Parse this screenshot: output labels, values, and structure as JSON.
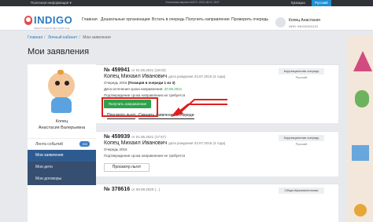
{
  "topbar": {
    "info": "Полезная информация ▾",
    "center": "Эталонная версия #0070: 2021.06.01 1537",
    "lang_kz": "Қазақша",
    "lang_ru": "Русский"
  },
  "header": {
    "logo": "INDIGO",
    "logo_sub": "ЭЛЕКТРОННЫЙ ДЕТСКИЙ САД",
    "nav": [
      "Главная",
      "Дошкольные организации",
      "Встать в очередь",
      "Получить направление",
      "Проверить очередь"
    ],
    "user_name": "Копец Анастасия",
    "user_iin": "ИИН: 940202401122"
  },
  "breadcrumbs": [
    "Главная",
    "Личный кабинет",
    "Мои заявления"
  ],
  "page_title": "Мои заявления",
  "sidebar": {
    "name_line1": "Копец",
    "name_line2": "Анастасия Валерьевна",
    "feed_label": "Лента событий",
    "feed_count": "153",
    "items": [
      "Мои заявления",
      "Мои дети",
      "Мои договоры"
    ]
  },
  "applications": [
    {
      "number": "№ 459941",
      "date": "от 01.06.2021 (18:03)",
      "child": "Копец Михаил Иванович",
      "dob": "дата рождения 23.07.2016 (4 года)",
      "queue": "Очередь 2016",
      "position_label": "Очередь 2016",
      "position": "(Позиция в очереди 1 из 3)",
      "expiry_label": "Дата истечения срока направления:",
      "expiry": "20.06.2021",
      "confirm": "Подтверждение срока направления не требуется",
      "status": "Коррекционная очередь",
      "lang": "Русский",
      "primary_btn": "Получить направление",
      "benefits_btn": "Просмотр льгот",
      "change_btn": "Сменить заявление с очереди"
    },
    {
      "number": "№ 459939",
      "date": "от 01.06.2021 (17:57)",
      "child": "Копец Михаил Иванович",
      "dob": "дата рождения 23.07.2016 (4 года)",
      "queue": "Очередь 2016",
      "confirm": "Подтверждение срока направления не требуется",
      "status": "Коррекционная очередь",
      "lang": "Русский",
      "benefits_btn": "Просмотр льгот"
    },
    {
      "number": "№ 378616",
      "date": "от 09.09.2020 (...)",
      "status": "Общеобразовательная"
    }
  ],
  "colors": {
    "accent": "#2a7bc4",
    "green": "#2ea24a",
    "highlight": "#e01e1e",
    "sidebar_active": "#2e5b8f"
  }
}
